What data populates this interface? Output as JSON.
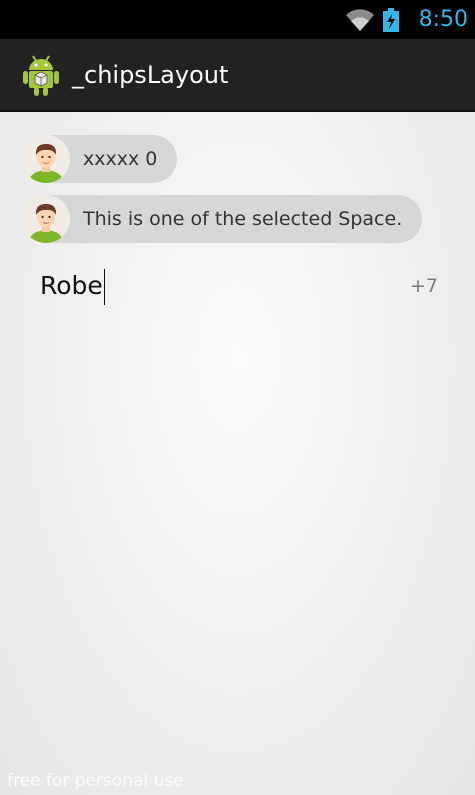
{
  "status_bar": {
    "time": "8:50",
    "icons": [
      "wifi-icon",
      "battery-charging-icon"
    ],
    "accent_color": "#33b5e5"
  },
  "action_bar": {
    "title": "_chipsLayout",
    "icon": "android-app-icon"
  },
  "chips": [
    {
      "label": "xxxxx 0",
      "avatar": "person-avatar"
    },
    {
      "label": "This is one of the selected Space.",
      "avatar": "person-avatar"
    }
  ],
  "input": {
    "value": "Robe",
    "more_count": "+7"
  },
  "watermark": "free for personal use"
}
